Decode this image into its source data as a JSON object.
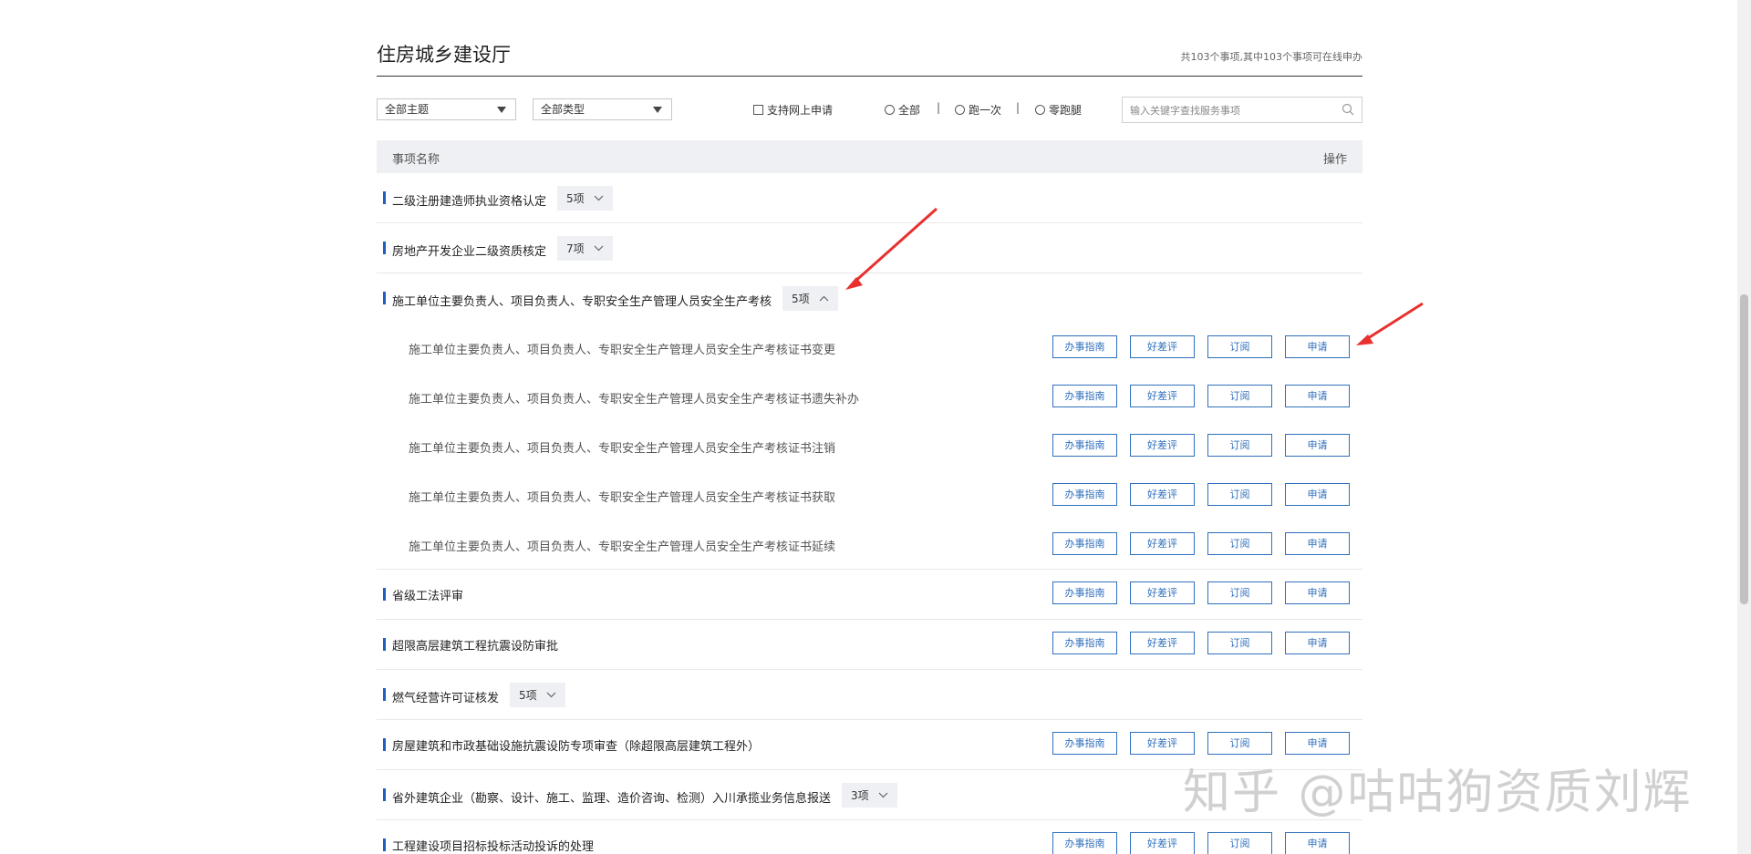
{
  "header": {
    "title": "住房城乡建设厅",
    "summary": "共103个事项,其中103个事项可在线申办"
  },
  "filters": {
    "theme_select": "全部主题",
    "type_select": "全部类型",
    "online_checkbox": "支持网上申请",
    "radio_all": "全部",
    "radio_once": "跑一次",
    "radio_zero": "零跑腿",
    "sep": "|",
    "search_placeholder": "输入关键字查找服务事项"
  },
  "table": {
    "col_name": "事项名称",
    "col_op": "操作"
  },
  "ops": {
    "guide": "办事指南",
    "rate": "好差评",
    "subscribe": "订阅",
    "apply": "申请"
  },
  "rows": [
    {
      "name": "二级注册建造师执业资格认定",
      "badge": "5项",
      "expanded": false
    },
    {
      "name": "房地产开发企业二级资质核定",
      "badge": "7项",
      "expanded": false
    },
    {
      "name": "施工单位主要负责人、项目负责人、专职安全生产管理人员安全生产考核",
      "badge": "5项",
      "expanded": true
    }
  ],
  "subrows": [
    "施工单位主要负责人、项目负责人、专职安全生产管理人员安全生产考核证书变更",
    "施工单位主要负责人、项目负责人、专职安全生产管理人员安全生产考核证书遗失补办",
    "施工单位主要负责人、项目负责人、专职安全生产管理人员安全生产考核证书注销",
    "施工单位主要负责人、项目负责人、专职安全生产管理人员安全生产考核证书获取",
    "施工单位主要负责人、项目负责人、专职安全生产管理人员安全生产考核证书延续"
  ],
  "rows_after": [
    {
      "name": "省级工法评审",
      "badge": null
    },
    {
      "name": "超限高层建筑工程抗震设防审批",
      "badge": null
    },
    {
      "name": "燃气经营许可证核发",
      "badge": "5项"
    },
    {
      "name": "房屋建筑和市政基础设施抗震设防专项审查（除超限高层建筑工程外）",
      "badge": null
    },
    {
      "name": "省外建筑企业（勘察、设计、施工、监理、造价咨询、检测）入川承揽业务信息报送",
      "badge": "3项"
    },
    {
      "name": "工程建设项目招标投标活动投诉的处理",
      "badge": null
    }
  ],
  "watermark": "知乎 @咕咕狗资质刘辉",
  "colors": {
    "accent": "#1f5fbf",
    "button_border": "#2f6fbd",
    "arrow": "#e8312f",
    "header_bg": "#eef0f3"
  }
}
